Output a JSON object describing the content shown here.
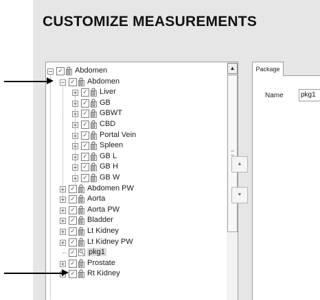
{
  "page_title": "CUSTOMIZE MEASUREMENTS",
  "tree": {
    "items": [
      {
        "label": "Abdomen",
        "expander": "−",
        "checked": true,
        "selected": false
      },
      {
        "label": "Abdomen",
        "expander": "−",
        "checked": true,
        "selected": false
      },
      {
        "label": "Liver",
        "expander": "+",
        "checked": true,
        "selected": false
      },
      {
        "label": "GB",
        "expander": "+",
        "checked": true,
        "selected": false
      },
      {
        "label": "GBWT",
        "expander": "+",
        "checked": true,
        "selected": false
      },
      {
        "label": "CBD",
        "expander": "+",
        "checked": true,
        "selected": false
      },
      {
        "label": "Portal Vein",
        "expander": "+",
        "checked": true,
        "selected": false
      },
      {
        "label": "Spleen",
        "expander": "+",
        "checked": true,
        "selected": false
      },
      {
        "label": "GB L",
        "expander": "+",
        "checked": true,
        "selected": false
      },
      {
        "label": "GB H",
        "expander": "+",
        "checked": true,
        "selected": false
      },
      {
        "label": "GB W",
        "expander": "+",
        "checked": true,
        "selected": false
      },
      {
        "label": "Abdomen PW",
        "expander": "+",
        "checked": true,
        "selected": false
      },
      {
        "label": "Aorta",
        "expander": "+",
        "checked": true,
        "selected": false
      },
      {
        "label": "Aorta PW",
        "expander": "+",
        "checked": true,
        "selected": false
      },
      {
        "label": "Bladder",
        "expander": "+",
        "checked": true,
        "selected": false
      },
      {
        "label": "Lt Kidney",
        "expander": "+",
        "checked": true,
        "selected": false
      },
      {
        "label": "Lt Kidney PW",
        "expander": "+",
        "checked": true,
        "selected": false
      },
      {
        "label": "pkg1",
        "expander": "",
        "checked": true,
        "selected": true
      },
      {
        "label": "Prostate",
        "expander": "+",
        "checked": true,
        "selected": false
      },
      {
        "label": "Rt Kidney",
        "expander": "+",
        "checked": true,
        "selected": false
      }
    ]
  },
  "move_up_glyph": "▲",
  "move_down_glyph": "▼",
  "scroll_up_glyph": "▲",
  "package_tab": {
    "label": "Package"
  },
  "package_form": {
    "name_label": "Name",
    "name_value": "pkg1"
  },
  "colors": {
    "panel_bg": "#e6e6e6",
    "arrow": "#000000"
  }
}
